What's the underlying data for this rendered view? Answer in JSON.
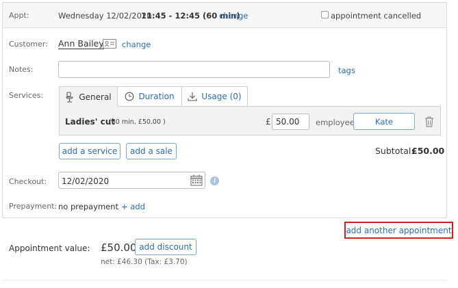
{
  "appt": {
    "label": "Appt:",
    "date": "Wednesday 12/02/2020",
    "time": "11:45 - 12:45 (60 min)",
    "change": "change",
    "cancelled_label": "appointment cancelled"
  },
  "customer": {
    "label": "Customer:",
    "name": "Ann Bailey",
    "change": "change"
  },
  "notes": {
    "label": "Notes:",
    "value": "",
    "tags": "tags"
  },
  "services": {
    "label": "Services:",
    "tabs": [
      {
        "label": "General",
        "icon": "chair-icon"
      },
      {
        "label": "Duration",
        "icon": "clock-icon"
      },
      {
        "label": "Usage (0)",
        "icon": "download-icon"
      }
    ],
    "items": [
      {
        "name": "Ladies' cut",
        "detail": "(60 min, £50.00 )",
        "currency": "£",
        "price": "50.00",
        "employee_label": "employee:",
        "employee": "Kate"
      }
    ],
    "add_service": "add a service",
    "add_sale": "add a sale",
    "subtotal_label": "Subtotal:",
    "subtotal_value": "£50.00"
  },
  "checkout": {
    "label": "Checkout:",
    "date": "12/02/2020"
  },
  "prepayment": {
    "label": "Prepayment:",
    "value": "no prepayment",
    "add": "+ add"
  },
  "add_another": "add another appointment",
  "value": {
    "label": "Appointment value:",
    "amount": "£50.00",
    "add_discount": "add discount",
    "net": "net: £46.30 (Tax: £3.70)"
  },
  "colors": {
    "link": "#2a6db5",
    "highlight_border": "#d62020",
    "panel_border": "#dcdcdc"
  }
}
